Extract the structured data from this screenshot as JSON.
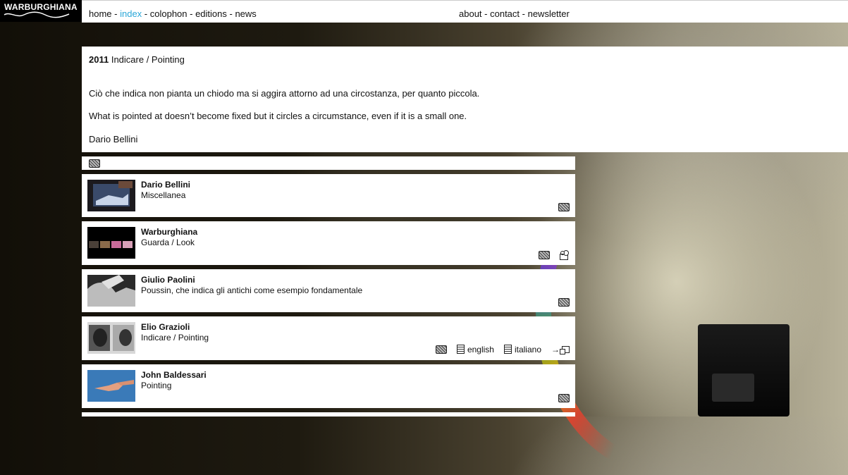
{
  "logo": {
    "text": "WARBURGHIANA"
  },
  "nav": {
    "left": [
      {
        "label": "home",
        "active": false
      },
      {
        "label": "index",
        "active": true
      },
      {
        "label": "colophon",
        "active": false
      },
      {
        "label": "editions",
        "active": false
      },
      {
        "label": "news",
        "active": false
      }
    ],
    "right": [
      {
        "label": "about"
      },
      {
        "label": "contact"
      },
      {
        "label": "newsletter"
      }
    ],
    "separator": " - ",
    "active_color": "#2aa7d8"
  },
  "intro": {
    "year": "2011",
    "title": "Indicare / Pointing",
    "text_it": "Ciò che indica non pianta un chiodo ma si aggira attorno ad una circostanza, per quanto piccola.",
    "text_en": "What is pointed at doesn’t become fixed but it circles a circumstance, even if it is a small one.",
    "author": "Dario Bellini"
  },
  "entries": [
    {
      "name": "Dario Bellini",
      "sub": "Miscellanea",
      "thumb": "screen-photo-thumbnail",
      "icons": [
        "film-icon"
      ]
    },
    {
      "name": "Warburghiana",
      "sub": "Guarda / Look",
      "thumb": "video-strip-thumbnail",
      "icons": [
        "film-icon",
        "camera-icon"
      ]
    },
    {
      "name": "Giulio Paolini",
      "sub": "Poussin, che indica gli antichi come esempio fondamentale",
      "thumb": "hand-photo-thumbnail",
      "icons": [
        "film-icon"
      ]
    },
    {
      "name": "Elio Grazioli",
      "sub": "Indicare / Pointing",
      "thumb": "two-faces-thumbnail",
      "icons": [
        "film-icon"
      ],
      "links": [
        {
          "icon": "document-icon",
          "label": "english"
        },
        {
          "icon": "document-icon",
          "label": "italiano"
        }
      ],
      "external": "external-window-icon"
    },
    {
      "name": "John Baldessari",
      "sub": "Pointing",
      "thumb": "pointing-hand-thumbnail",
      "icons": [
        "film-icon"
      ]
    }
  ]
}
